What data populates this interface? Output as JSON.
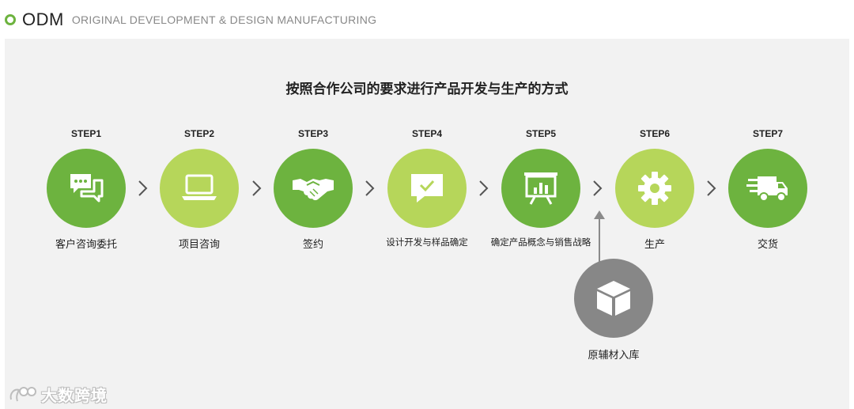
{
  "header": {
    "title": "ODM",
    "subtitle": "ORIGINAL DEVELOPMENT & DESIGN MANUFACTURING"
  },
  "main_title": "按照合作公司的要求进行产品开发与生产的方式",
  "steps": [
    {
      "label": "STEP1",
      "name": "客户咨询委托",
      "icon": "chat-icon"
    },
    {
      "label": "STEP2",
      "name": "项目咨询",
      "icon": "laptop-icon"
    },
    {
      "label": "STEP3",
      "name": "签约",
      "icon": "handshake-icon"
    },
    {
      "label": "STEP4",
      "name": "设计开发与样品确定",
      "icon": "check-message-icon"
    },
    {
      "label": "STEP5",
      "name": "确定产品概念与销售战略",
      "icon": "presentation-chart-icon"
    },
    {
      "label": "STEP6",
      "name": "生产",
      "icon": "gear-icon"
    },
    {
      "label": "STEP7",
      "name": "交货",
      "icon": "delivery-truck-icon"
    }
  ],
  "raw_material": {
    "name": "原辅材入库",
    "icon": "box-icon"
  },
  "watermark": {
    "text": "大数跨境",
    "icon": "watermark-logo-icon"
  },
  "colors": {
    "dark_green": "#6db33f",
    "light_green": "#b6d65a",
    "gray": "#878787",
    "panel": "#f2f2f2"
  }
}
